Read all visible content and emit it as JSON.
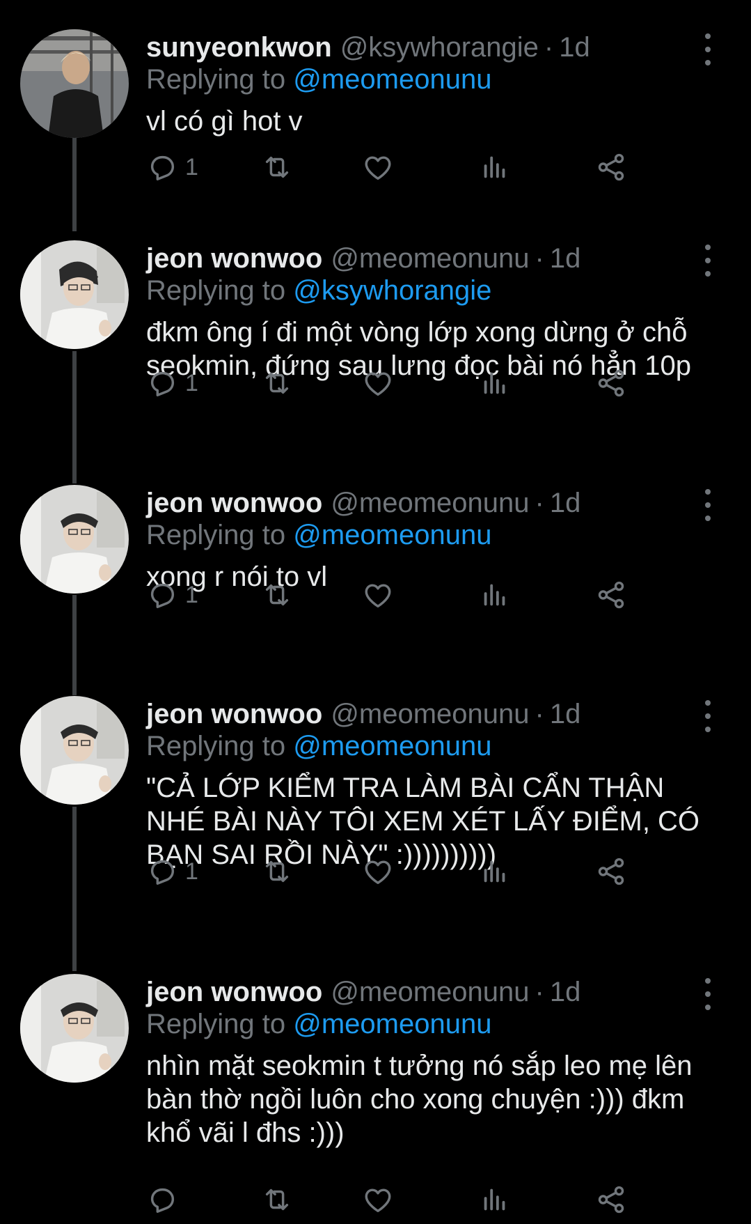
{
  "tweets": [
    {
      "name": "sunyeonkwon",
      "handle": "@ksywhorangie",
      "time": "1d",
      "replying_label": "Replying to",
      "replying_to": "@meomeonunu",
      "text": "vl có gì hot v",
      "reply_count": "1"
    },
    {
      "name": "jeon wonwoo",
      "handle": "@meomeonunu",
      "time": "1d",
      "replying_label": "Replying to",
      "replying_to": "@ksywhorangie",
      "text": "đkm ông í đi một vòng lớp xong dừng ở chỗ seokmin, đứng sau lưng đọc bài nó hẳn 10p",
      "reply_count": "1"
    },
    {
      "name": "jeon wonwoo",
      "handle": "@meomeonunu",
      "time": "1d",
      "replying_label": "Replying to",
      "replying_to": "@meomeonunu",
      "text": "xong r nói to vl",
      "reply_count": "1"
    },
    {
      "name": "jeon wonwoo",
      "handle": "@meomeonunu",
      "time": "1d",
      "replying_label": "Replying to",
      "replying_to": "@meomeonunu",
      "text": "\"CẢ LỚP KIỂM TRA LÀM BÀI CẨN THẬN NHÉ BÀI NÀY TÔI XEM XÉT LẤY ĐIỂM, CÓ BẠN SAI RỒI NÀY\" :))))))))))",
      "reply_count": "1"
    },
    {
      "name": "jeon wonwoo",
      "handle": "@meomeonunu",
      "time": "1d",
      "replying_label": "Replying to",
      "replying_to": "@meomeonunu",
      "text": "nhìn mặt seokmin t tưởng nó sắp leo mẹ lên bàn thờ ngồi luôn cho xong chuyện :))) đkm khổ vãi l đhs :)))",
      "reply_count": ""
    }
  ],
  "separator": "·",
  "colors": {
    "background": "#000000",
    "text": "#e7e9ea",
    "muted": "#71767b",
    "link": "#1d9bf0",
    "thread_line": "#3e4144"
  },
  "icons": [
    "reply-icon",
    "retweet-icon",
    "like-icon",
    "views-icon",
    "share-icon",
    "more-icon"
  ]
}
